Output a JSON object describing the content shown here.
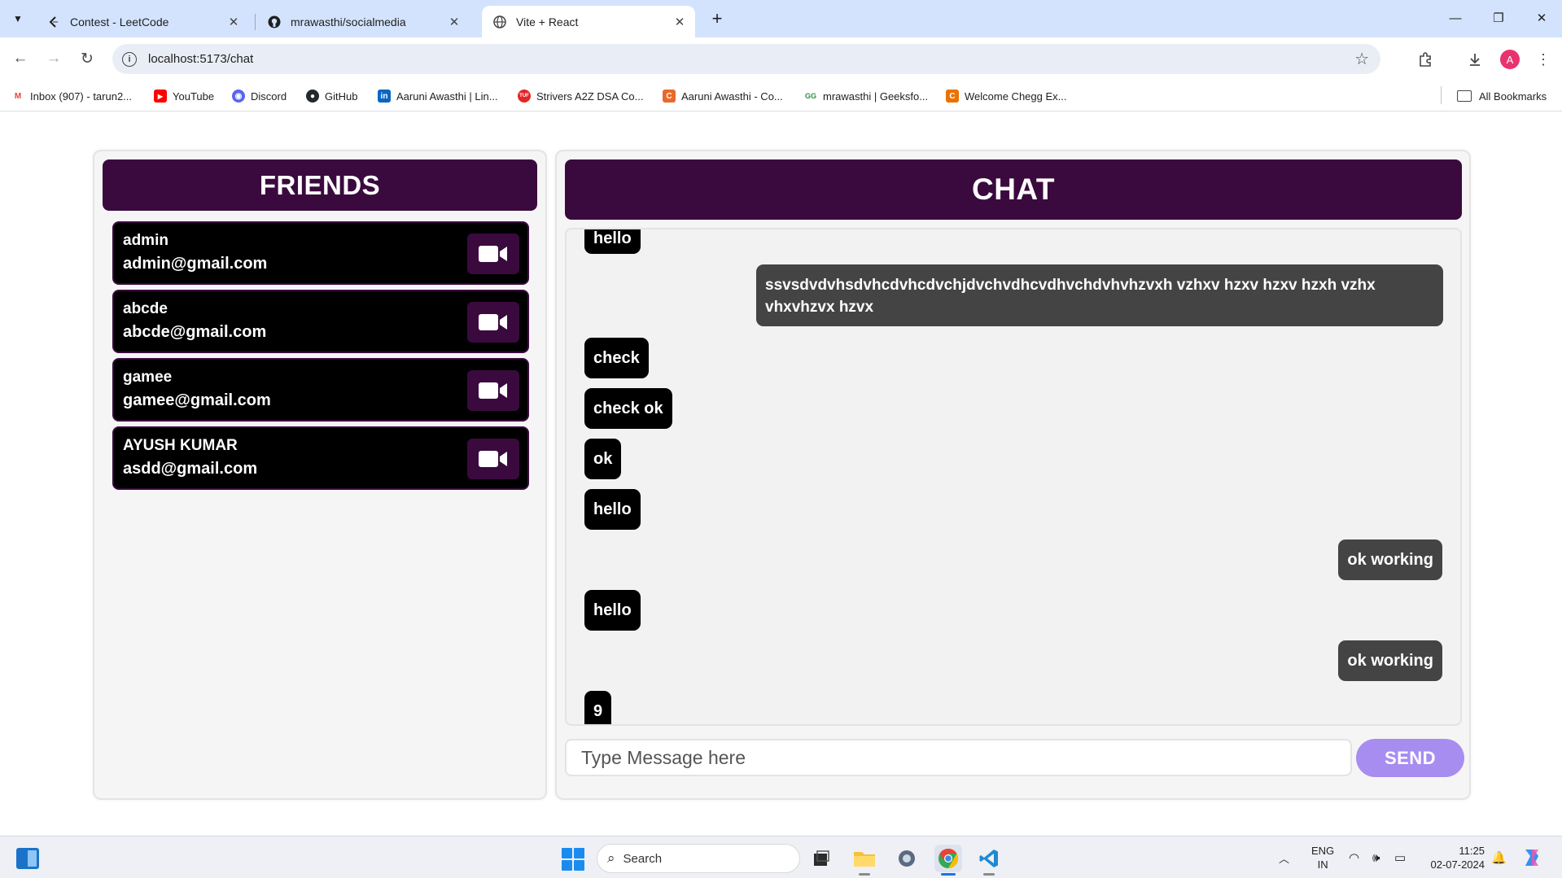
{
  "browser": {
    "tabs": [
      {
        "title": "Contest - LeetCode",
        "icon": "leetcode-icon",
        "active": false
      },
      {
        "title": "mrawasthi/socialmedia",
        "icon": "github-icon",
        "active": false
      },
      {
        "title": "Vite + React",
        "icon": "globe-icon",
        "active": true
      }
    ],
    "url": "localhost:5173/chat",
    "profile_initial": "A",
    "bookmarks": [
      {
        "label": "Inbox (907) - tarun2...",
        "icon": "gmail-icon",
        "color": "#ea4335",
        "glyph": "M"
      },
      {
        "label": "YouTube",
        "icon": "youtube-icon",
        "color": "#ff0000",
        "glyph": "▶"
      },
      {
        "label": "Discord",
        "icon": "discord-icon",
        "color": "#5865f2",
        "glyph": "◉"
      },
      {
        "label": "GitHub",
        "icon": "github-icon",
        "color": "#24292f",
        "glyph": "●"
      },
      {
        "label": "Aaruni Awasthi | Lin...",
        "icon": "linkedin-icon",
        "color": "#0a66c2",
        "glyph": "in"
      },
      {
        "label": "Strivers A2Z DSA Co...",
        "icon": "takeuforward-icon",
        "color": "#e52525",
        "glyph": "TUF"
      },
      {
        "label": "Aaruni Awasthi - Co...",
        "icon": "codechef-icon",
        "color": "#e86a2b",
        "glyph": "C"
      },
      {
        "label": "mrawasthi | Geeksfo...",
        "icon": "geeksforgeeks-icon",
        "color": "#2f8d46",
        "glyph": "GG"
      },
      {
        "label": "Welcome Chegg Ex...",
        "icon": "chegg-icon",
        "color": "#eb7100",
        "glyph": "C"
      }
    ],
    "all_bookmarks_label": "All Bookmarks"
  },
  "friends": {
    "title": "FRIENDS",
    "list": [
      {
        "name": "admin",
        "email": "admin@gmail.com"
      },
      {
        "name": "abcde",
        "email": "abcde@gmail.com"
      },
      {
        "name": "gamee",
        "email": "gamee@gmail.com"
      },
      {
        "name": "AYUSH KUMAR",
        "email": "asdd@gmail.com"
      }
    ]
  },
  "chat": {
    "title": "CHAT",
    "messages": [
      {
        "text": "hello",
        "side": "left"
      },
      {
        "text": "ssvsdvdvhsdvhcdvhcdvchjdvchvdhcvdhvchdvhvhzvxh vzhxv hzxv hzxv hzxh vzhx vhxvhzvx hzvx",
        "side": "right"
      },
      {
        "text": "check",
        "side": "left"
      },
      {
        "text": "check ok",
        "side": "left"
      },
      {
        "text": "ok",
        "side": "left"
      },
      {
        "text": "hello",
        "side": "left"
      },
      {
        "text": "ok working",
        "side": "right"
      },
      {
        "text": "hello",
        "side": "left"
      },
      {
        "text": "ok working",
        "side": "right"
      },
      {
        "text": "9",
        "side": "left"
      }
    ],
    "input_placeholder": "Type Message here",
    "input_value": "",
    "send_label": "SEND"
  },
  "taskbar": {
    "search_placeholder": "Search",
    "lang_line1": "ENG",
    "lang_line2": "IN",
    "time": "11:25",
    "date": "02-07-2024"
  },
  "colors": {
    "header_purple": "#3a0a3e",
    "send_button": "#a88df0",
    "incoming_bubble": "#000000",
    "outgoing_bubble": "#444444"
  }
}
